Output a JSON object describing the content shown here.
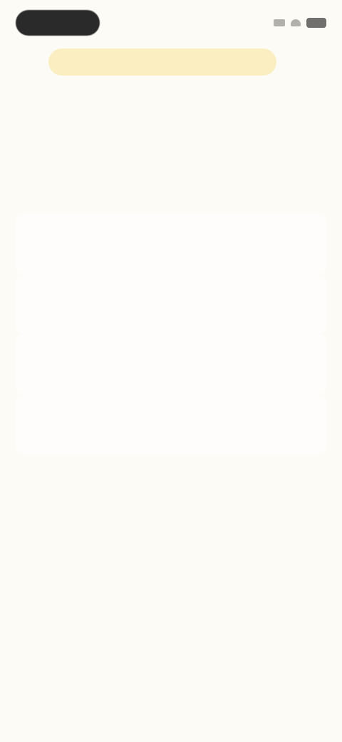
{
  "status_bar": {
    "pill_label": "",
    "icons": [
      "signal-icon",
      "wifi-icon",
      "battery-icon"
    ]
  },
  "banner": {
    "label": ""
  },
  "headline": "",
  "subhead": "",
  "options": [
    {
      "label": ""
    },
    {
      "label": ""
    },
    {
      "label": ""
    },
    {
      "label": ""
    }
  ],
  "colors": {
    "background": "#fdfbf6",
    "banner_bg": "#fbefc2",
    "pill_bg": "#2a2a2a"
  }
}
